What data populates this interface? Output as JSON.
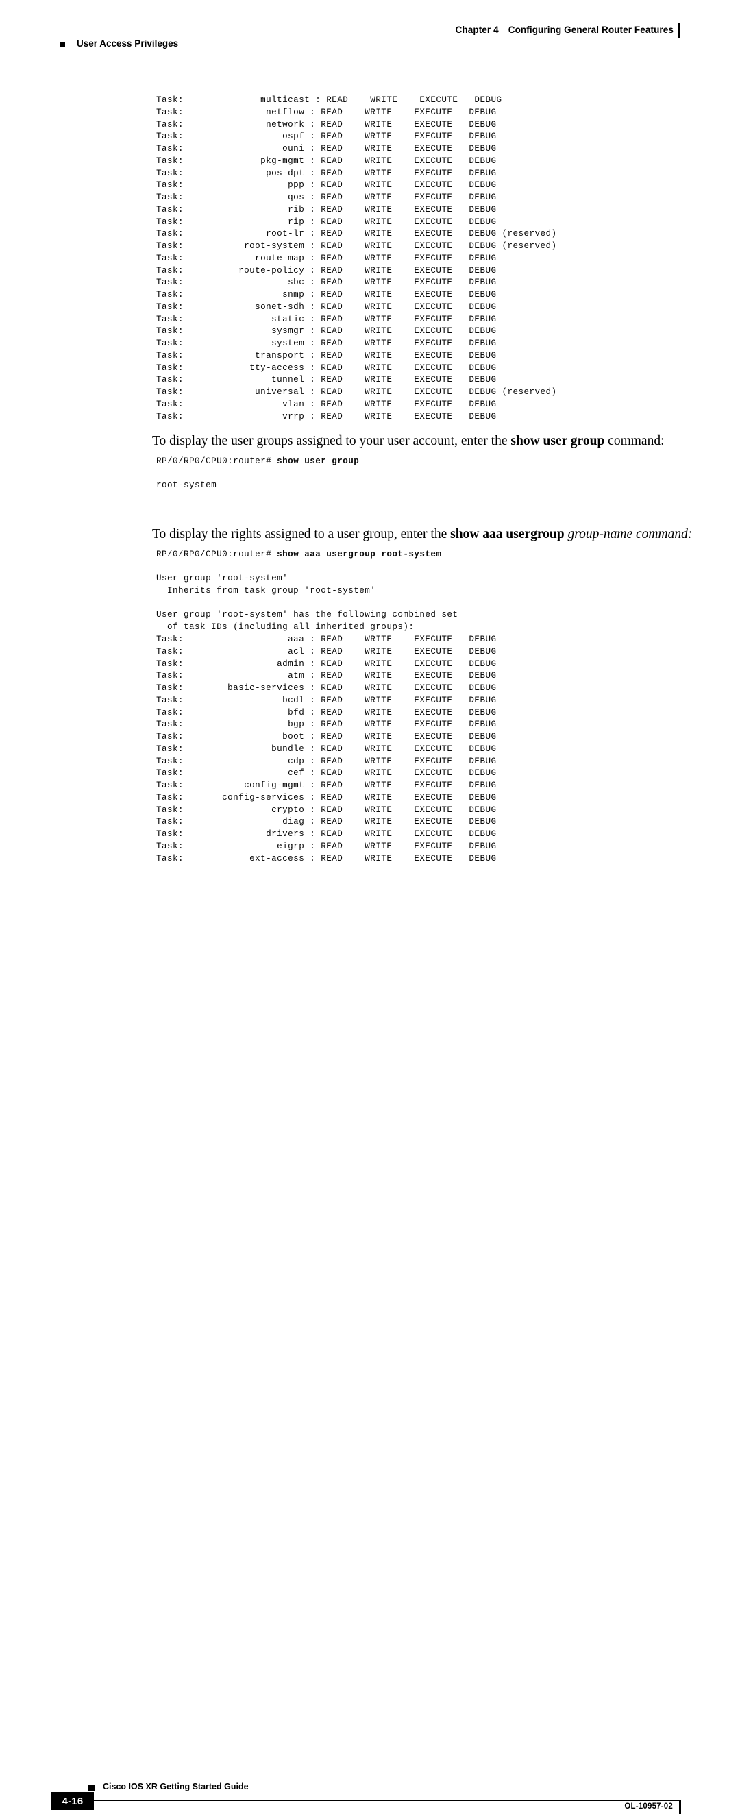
{
  "header": {
    "chapter_label": "Chapter 4",
    "chapter_title": "Configuring General Router Features",
    "section_title": "User Access Privileges"
  },
  "footer": {
    "page_number": "4-16",
    "guide_title": "Cisco IOS XR Getting Started Guide",
    "doc_id": "OL-10957-02"
  },
  "blocks": {
    "task_list_top": "Task:              multicast : READ    WRITE    EXECUTE   DEBUG\nTask:               netflow : READ    WRITE    EXECUTE   DEBUG\nTask:               network : READ    WRITE    EXECUTE   DEBUG\nTask:                  ospf : READ    WRITE    EXECUTE   DEBUG\nTask:                  ouni : READ    WRITE    EXECUTE   DEBUG\nTask:              pkg-mgmt : READ    WRITE    EXECUTE   DEBUG\nTask:               pos-dpt : READ    WRITE    EXECUTE   DEBUG\nTask:                   ppp : READ    WRITE    EXECUTE   DEBUG\nTask:                   qos : READ    WRITE    EXECUTE   DEBUG\nTask:                   rib : READ    WRITE    EXECUTE   DEBUG\nTask:                   rip : READ    WRITE    EXECUTE   DEBUG\nTask:               root-lr : READ    WRITE    EXECUTE   DEBUG (reserved)\nTask:           root-system : READ    WRITE    EXECUTE   DEBUG (reserved)\nTask:             route-map : READ    WRITE    EXECUTE   DEBUG\nTask:          route-policy : READ    WRITE    EXECUTE   DEBUG\nTask:                   sbc : READ    WRITE    EXECUTE   DEBUG\nTask:                  snmp : READ    WRITE    EXECUTE   DEBUG\nTask:             sonet-sdh : READ    WRITE    EXECUTE   DEBUG\nTask:                static : READ    WRITE    EXECUTE   DEBUG\nTask:                sysmgr : READ    WRITE    EXECUTE   DEBUG\nTask:                system : READ    WRITE    EXECUTE   DEBUG\nTask:             transport : READ    WRITE    EXECUTE   DEBUG\nTask:            tty-access : READ    WRITE    EXECUTE   DEBUG\nTask:                tunnel : READ    WRITE    EXECUTE   DEBUG\nTask:             universal : READ    WRITE    EXECUTE   DEBUG (reserved)\nTask:                  vlan : READ    WRITE    EXECUTE   DEBUG\nTask:                  vrrp : READ    WRITE    EXECUTE   DEBUG",
    "para_user_group": {
      "lead": "To display the user groups assigned to your user account, enter the ",
      "command": "show user group",
      "tail": " command:"
    },
    "cli_show_user_group_prompt": "RP/0/RP0/CPU0:router# ",
    "cli_show_user_group_cmd": "show user group",
    "cli_show_user_group_output": "root-system",
    "para_usergroup_rights": {
      "lead": "To display the rights assigned to a user group, enter the ",
      "command": "show aaa usergroup",
      "argument": "group-name",
      "tail": " command:"
    },
    "cli_show_aaa_prompt": "RP/0/RP0/CPU0:router# ",
    "cli_show_aaa_cmd": "show aaa usergroup root-system",
    "cli_show_aaa_output_head": "User group 'root-system'\n  Inherits from task group 'root-system'\n\nUser group 'root-system' has the following combined set\n  of task IDs (including all inherited groups):",
    "task_list_bottom": "Task:                   aaa : READ    WRITE    EXECUTE   DEBUG\nTask:                   acl : READ    WRITE    EXECUTE   DEBUG\nTask:                 admin : READ    WRITE    EXECUTE   DEBUG\nTask:                   atm : READ    WRITE    EXECUTE   DEBUG\nTask:        basic-services : READ    WRITE    EXECUTE   DEBUG\nTask:                  bcdl : READ    WRITE    EXECUTE   DEBUG\nTask:                   bfd : READ    WRITE    EXECUTE   DEBUG\nTask:                   bgp : READ    WRITE    EXECUTE   DEBUG\nTask:                  boot : READ    WRITE    EXECUTE   DEBUG\nTask:                bundle : READ    WRITE    EXECUTE   DEBUG\nTask:                   cdp : READ    WRITE    EXECUTE   DEBUG\nTask:                   cef : READ    WRITE    EXECUTE   DEBUG\nTask:           config-mgmt : READ    WRITE    EXECUTE   DEBUG\nTask:       config-services : READ    WRITE    EXECUTE   DEBUG\nTask:                crypto : READ    WRITE    EXECUTE   DEBUG\nTask:                  diag : READ    WRITE    EXECUTE   DEBUG\nTask:               drivers : READ    WRITE    EXECUTE   DEBUG\nTask:                 eigrp : READ    WRITE    EXECUTE   DEBUG\nTask:            ext-access : READ    WRITE    EXECUTE   DEBUG"
  }
}
